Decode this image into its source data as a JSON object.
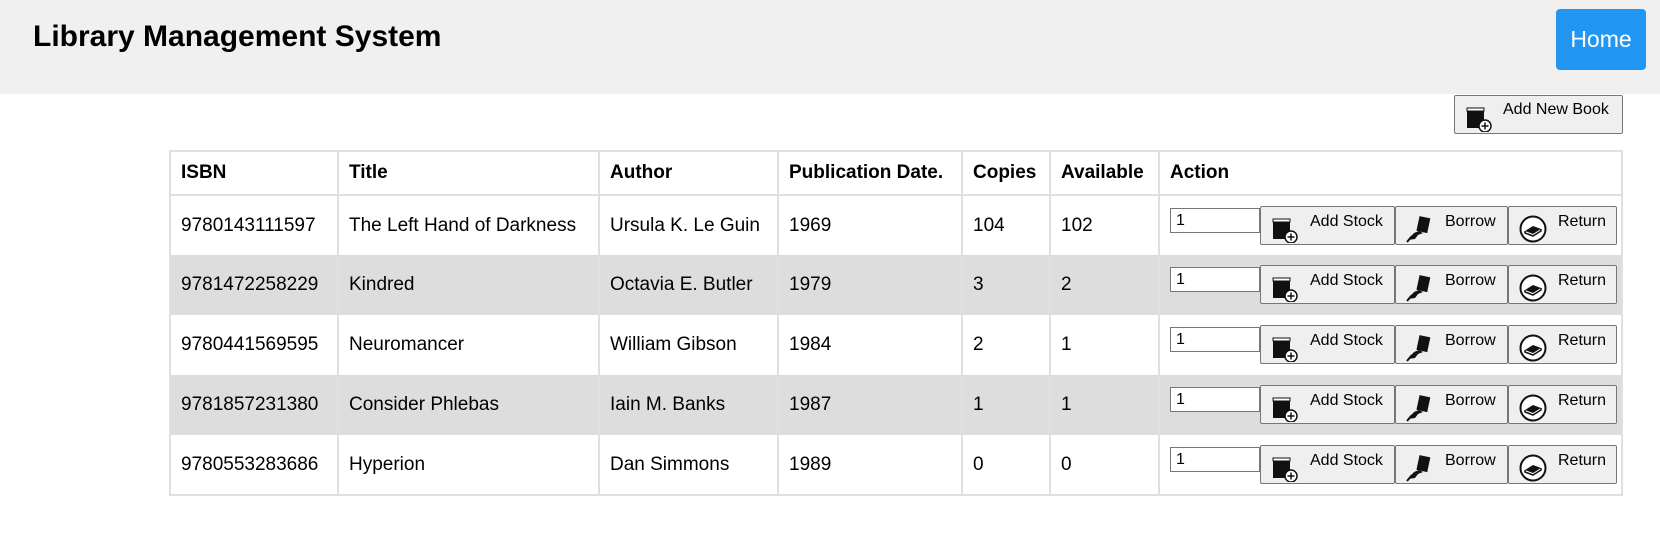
{
  "header": {
    "title": "Library Management System",
    "home_label": "Home"
  },
  "toolbar": {
    "add_new_label": "Add New Book"
  },
  "table": {
    "columns": [
      "ISBN",
      "Title",
      "Author",
      "Publication Date.",
      "Copies",
      "Available",
      "Action"
    ],
    "rows": [
      {
        "isbn": "9780143111597",
        "title": "The Left Hand of Darkness",
        "author": "Ursula K. Le Guin",
        "date": "1969",
        "copies": "104",
        "available": "102",
        "qty": "1"
      },
      {
        "isbn": "9781472258229",
        "title": "Kindred",
        "author": "Octavia E. Butler",
        "date": "1979",
        "copies": "3",
        "available": "2",
        "qty": "1"
      },
      {
        "isbn": "9780441569595",
        "title": "Neuromancer",
        "author": "William Gibson",
        "date": "1984",
        "copies": "2",
        "available": "1",
        "qty": "1"
      },
      {
        "isbn": "9781857231380",
        "title": "Consider Phlebas",
        "author": "Iain M. Banks",
        "date": "1987",
        "copies": "1",
        "available": "1",
        "qty": "1"
      },
      {
        "isbn": "9780553283686",
        "title": "Hyperion",
        "author": "Dan Simmons",
        "date": "1989",
        "copies": "0",
        "available": "0",
        "qty": "1"
      }
    ],
    "actions": {
      "add_stock": "Add Stock",
      "borrow": "Borrow",
      "return": "Return"
    }
  },
  "icons": {
    "add_book": "book-plus-icon",
    "borrow": "hand-book-icon",
    "return": "return-book-icon"
  },
  "colors": {
    "header_bg": "#f0f0f0",
    "home_bg": "#2196f3",
    "alt_row_bg": "#dddddd"
  }
}
